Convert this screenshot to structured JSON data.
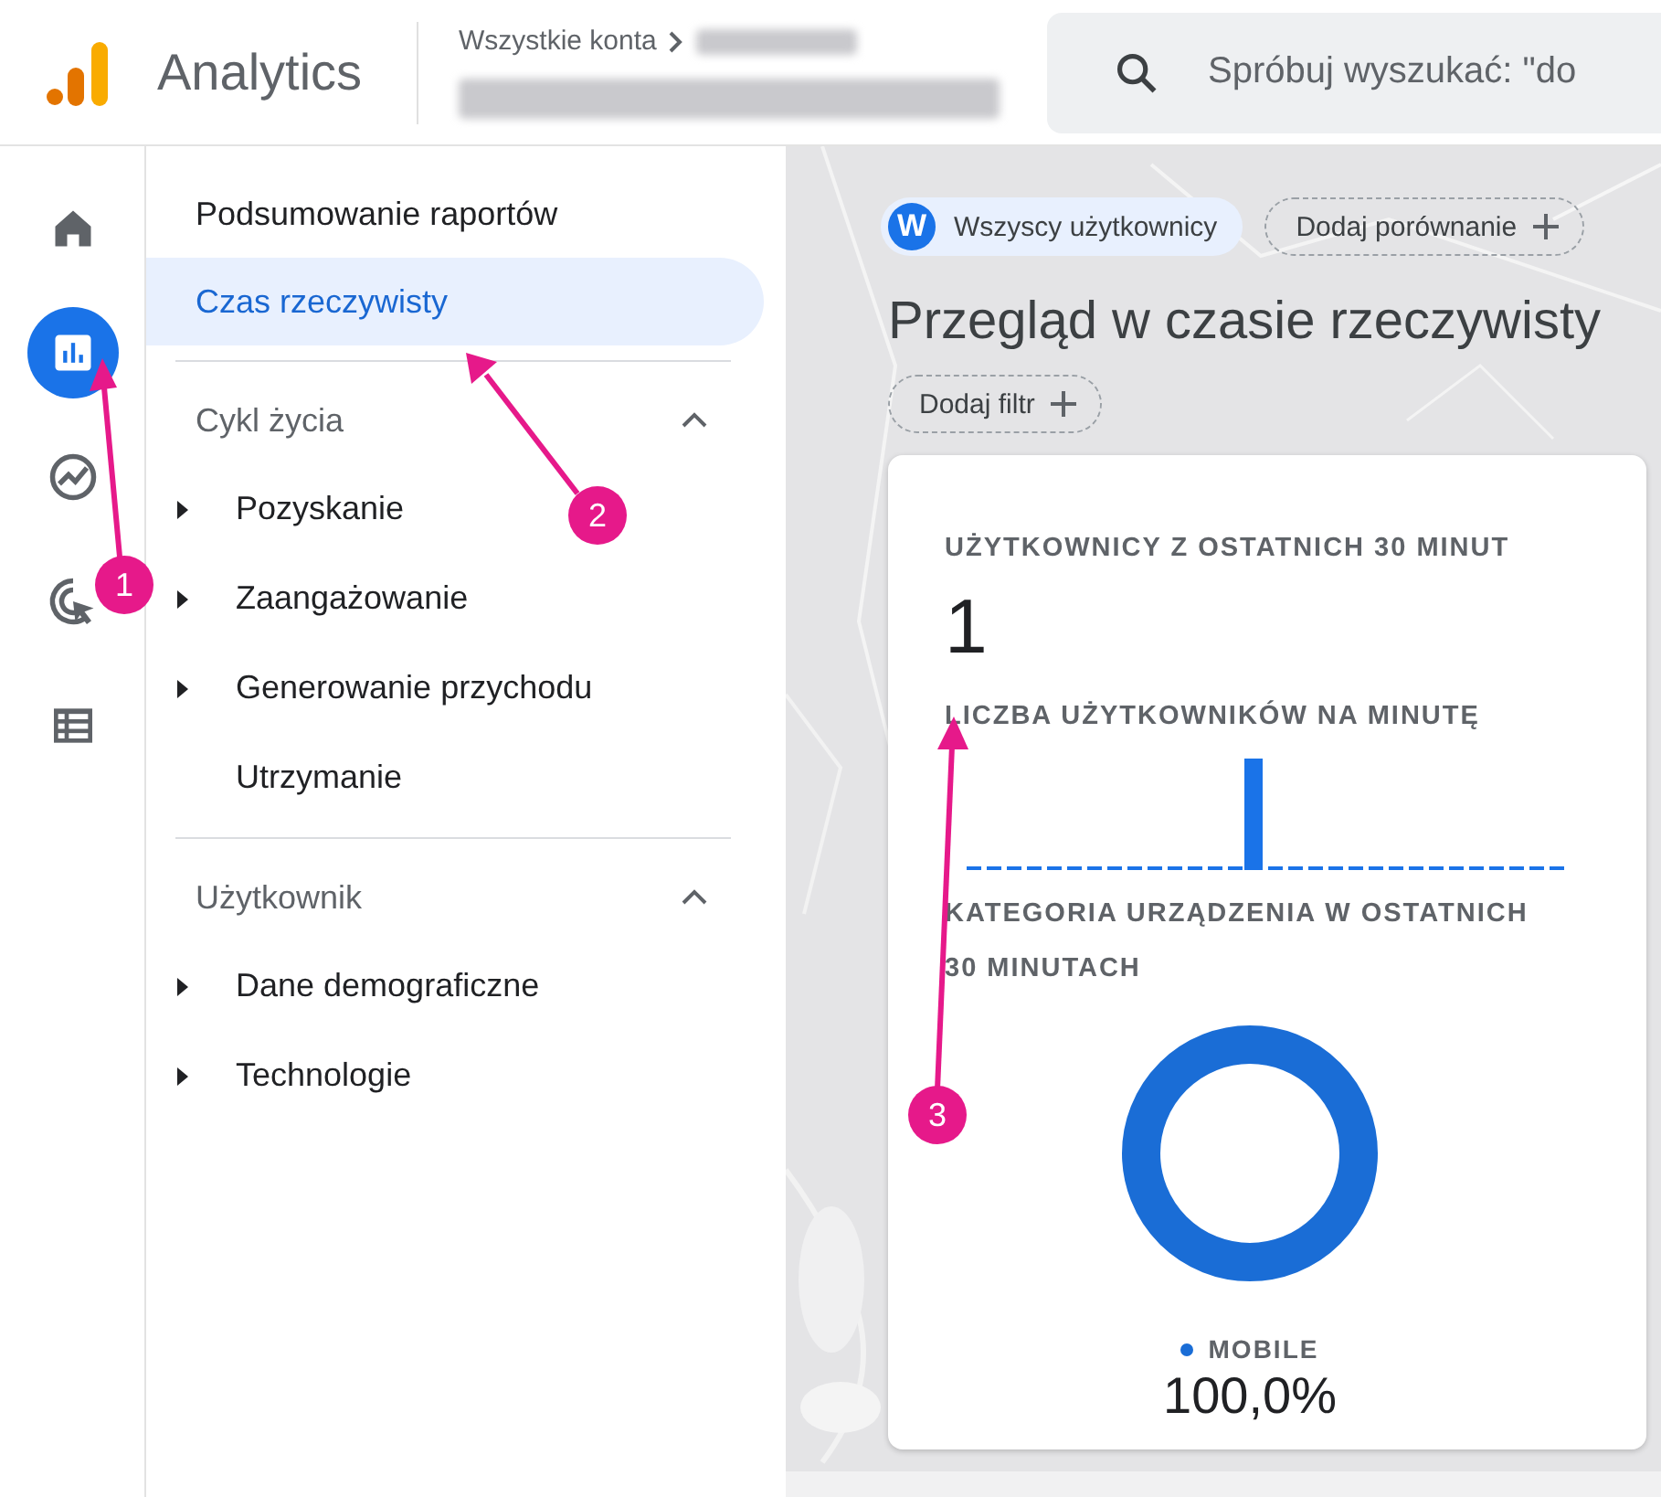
{
  "header": {
    "logo_text": "Analytics",
    "breadcrumb": "Wszystkie konta",
    "search": {
      "placeholder": "Spróbuj wyszukać: \"do"
    }
  },
  "rail_items": [
    {
      "selected": false
    },
    {
      "selected": true
    },
    {
      "selected": false
    },
    {
      "selected": false
    },
    {
      "selected": false
    }
  ],
  "nav": [
    {
      "kind": "link",
      "label": "Podsumowanie raportów",
      "selected": false
    },
    {
      "kind": "link",
      "label": "Czas rzeczywisty",
      "selected": true
    },
    {
      "kind": "section",
      "label": "Cykl życia",
      "expanded": true,
      "children": [
        {
          "label": "Pozyskanie",
          "has_children": true
        },
        {
          "label": "Zaangażowanie",
          "has_children": true
        },
        {
          "label": "Generowanie przychodu",
          "has_children": true
        },
        {
          "label": "Utrzymanie",
          "has_children": false
        }
      ]
    },
    {
      "kind": "section",
      "label": "Użytkownik",
      "expanded": true,
      "children": [
        {
          "label": "Dane demograficzne",
          "has_children": true
        },
        {
          "label": "Technologie",
          "has_children": true
        }
      ]
    }
  ],
  "comparison": {
    "segment_badge": "W",
    "segment_label": "Wszyscy użytkownicy",
    "add_button": "Dodaj porównanie"
  },
  "title": "Przegląd w czasie rzeczywisty",
  "filter_button": "Dodaj filtr",
  "card": {
    "users_title": "UŻYTKOWNICY Z OSTATNICH 30 MINUT",
    "users_value": "1",
    "per_minute_title": "LICZBA UŻYTKOWNIKÓW NA MINUTĘ",
    "device_title": "KATEGORIA URZĄDZENIA W OSTATNICH 30 MINUTACH",
    "legend": [
      {
        "label": "MOBILE",
        "value": "100,0%",
        "color": "#1a6dd6"
      }
    ]
  },
  "annotations": [
    {
      "number": "1"
    },
    {
      "number": "2"
    },
    {
      "number": "3"
    }
  ]
}
